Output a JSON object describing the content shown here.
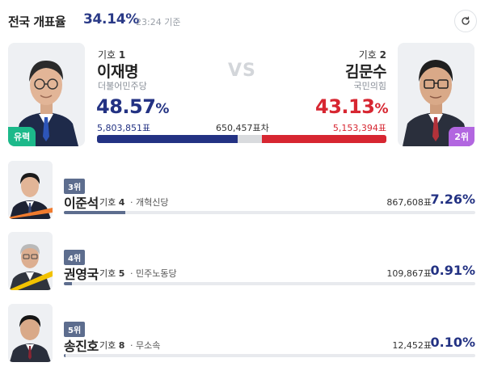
{
  "header": {
    "title": "전국 개표율",
    "rate": "34.14",
    "rate_unit": "%",
    "time": "23:24 기준"
  },
  "main": {
    "vs_label": "VS",
    "gap_votes": "650,457표차",
    "candidate1": {
      "number_label": "기호",
      "number": "1",
      "name": "이재명",
      "party": "더불어민주당",
      "percent": "48.57",
      "percent_unit": "%",
      "votes": "5,803,851표",
      "tag": "유력",
      "share": 0.4857,
      "color": "#233283"
    },
    "candidate2": {
      "number_label": "기호",
      "number": "2",
      "name": "김문수",
      "party": "국민의힘",
      "percent": "43.13",
      "percent_unit": "%",
      "votes": "5,153,394표",
      "tag": "2위",
      "share": 0.4313,
      "color": "#d72631"
    }
  },
  "others": [
    {
      "rank": "3위",
      "name": "이준석",
      "number_label": "기호",
      "number": "4",
      "party": "· 개혁신당",
      "votes": "867,608표",
      "percent": "7.26%",
      "share": 0.0726,
      "photo_accent": "#f07b2e"
    },
    {
      "rank": "4위",
      "name": "권영국",
      "number_label": "기호",
      "number": "5",
      "party": "· 민주노동당",
      "votes": "109,867표",
      "percent": "0.91%",
      "share": 0.0091,
      "photo_accent": "#f2c200"
    },
    {
      "rank": "5위",
      "name": "송진호",
      "number_label": "기호",
      "number": "8",
      "party": "· 무소속",
      "votes": "12,452표",
      "percent": "0.10%",
      "share": 0.001,
      "photo_accent": "#d0d3d8"
    }
  ],
  "icons": {
    "refresh": "refresh-icon"
  }
}
